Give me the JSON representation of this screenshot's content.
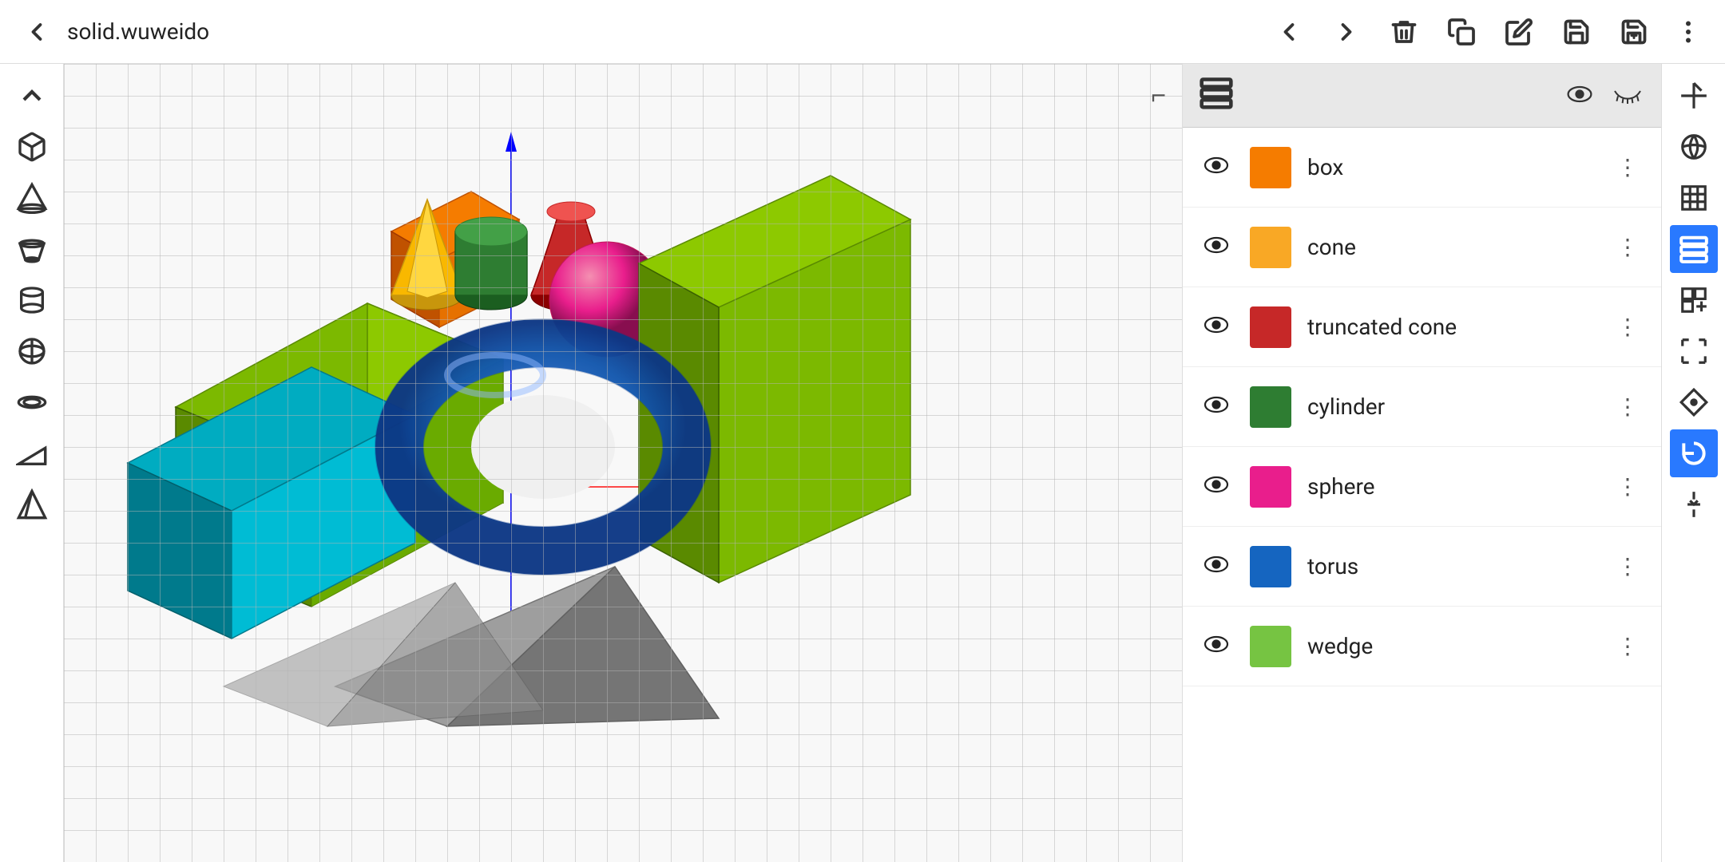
{
  "header": {
    "back_label": "←",
    "title": "solid.wuweido",
    "nav_back": "←",
    "nav_forward": "→",
    "delete_label": "🗑",
    "copy_label": "⊞",
    "edit_label": "✏",
    "save_label": "💾",
    "save_plus_label": "💾+",
    "more_label": "⋮"
  },
  "left_sidebar": {
    "items": [
      {
        "name": "collapse-icon",
        "symbol": "∧"
      },
      {
        "name": "box-icon",
        "symbol": "□"
      },
      {
        "name": "cone-icon",
        "symbol": "△"
      },
      {
        "name": "truncated-cone-icon",
        "symbol": "◠"
      },
      {
        "name": "cylinder-icon",
        "symbol": "⊡"
      },
      {
        "name": "sphere-icon",
        "symbol": "◎"
      },
      {
        "name": "torus-icon",
        "symbol": "○"
      },
      {
        "name": "wedge-icon",
        "symbol": "◁"
      },
      {
        "name": "pyramid-icon",
        "symbol": "△"
      }
    ]
  },
  "panel": {
    "header_icon": "layers",
    "show_all_label": "show all",
    "hide_all_label": "hide all"
  },
  "objects": [
    {
      "id": "box",
      "name": "box",
      "color": "#f57c00",
      "visible": true
    },
    {
      "id": "cone",
      "name": "cone",
      "color": "#f9a825",
      "visible": true
    },
    {
      "id": "truncated_cone",
      "name": "truncated cone",
      "color": "#c62828",
      "visible": true
    },
    {
      "id": "cylinder",
      "name": "cylinder",
      "color": "#2e7d32",
      "visible": true
    },
    {
      "id": "sphere",
      "name": "sphere",
      "color": "#e91e8c",
      "visible": true
    },
    {
      "id": "torus",
      "name": "torus",
      "color": "#1565c0",
      "visible": true
    },
    {
      "id": "wedge",
      "name": "wedge",
      "color": "#76c442",
      "visible": true
    }
  ],
  "right_toolbar": {
    "items": [
      {
        "name": "axis-icon",
        "symbol": "⊹",
        "active": false
      },
      {
        "name": "view3d-icon",
        "symbol": "◈",
        "active": false
      },
      {
        "name": "grid-icon",
        "symbol": "⊞",
        "active": false
      },
      {
        "name": "layers-icon",
        "symbol": "▤",
        "active": true,
        "color": "blue"
      },
      {
        "name": "transform-icon",
        "symbol": "◇",
        "active": false
      },
      {
        "name": "select-icon",
        "symbol": "⌐",
        "active": false
      },
      {
        "name": "move-icon",
        "symbol": "⊕",
        "active": false
      },
      {
        "name": "rotate-icon",
        "symbol": "↺",
        "active": true,
        "color": "blue"
      },
      {
        "name": "snap-icon",
        "symbol": "↧",
        "active": false
      }
    ]
  },
  "scene": {
    "shapes": [
      "green prism (left)",
      "teal box",
      "orange box",
      "gold cone",
      "green cylinder",
      "red truncated cone",
      "magenta sphere",
      "green wedge (right)",
      "blue torus",
      "gray pyramid",
      "gray pyramid2"
    ]
  }
}
